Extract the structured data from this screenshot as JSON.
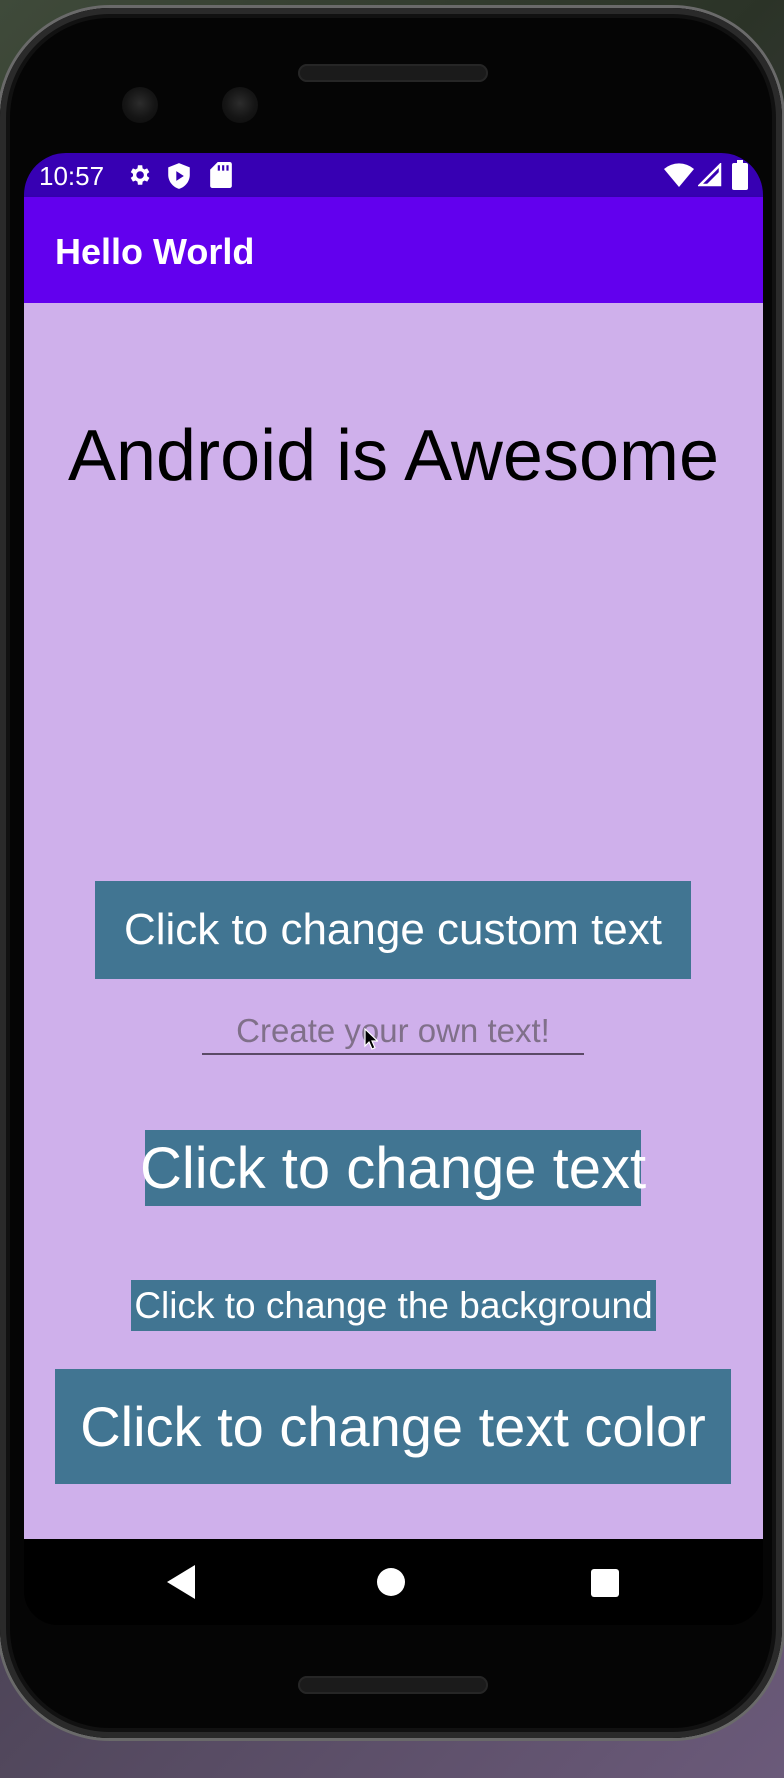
{
  "status_bar": {
    "time": "10:57",
    "icons_left": [
      "gear-icon",
      "shield-play-icon",
      "sd-card-icon"
    ],
    "icons_right": [
      "wifi-icon",
      "cell-signal-icon",
      "battery-icon"
    ]
  },
  "app_bar": {
    "title": "Hello World",
    "color": "#6200ee"
  },
  "main": {
    "background": "#cfb0eb",
    "headline": "Android is Awesome",
    "custom_text_button": "Click to change custom text",
    "custom_text_input": {
      "placeholder": "Create your own text!",
      "value": ""
    },
    "change_text_button": "Click to change text",
    "change_background_button": "Click to change the background",
    "change_text_color_button": "Click to change text color",
    "button_color": "#417592"
  },
  "nav_bar": {
    "buttons": [
      "back-icon",
      "home-icon",
      "recents-icon"
    ]
  }
}
